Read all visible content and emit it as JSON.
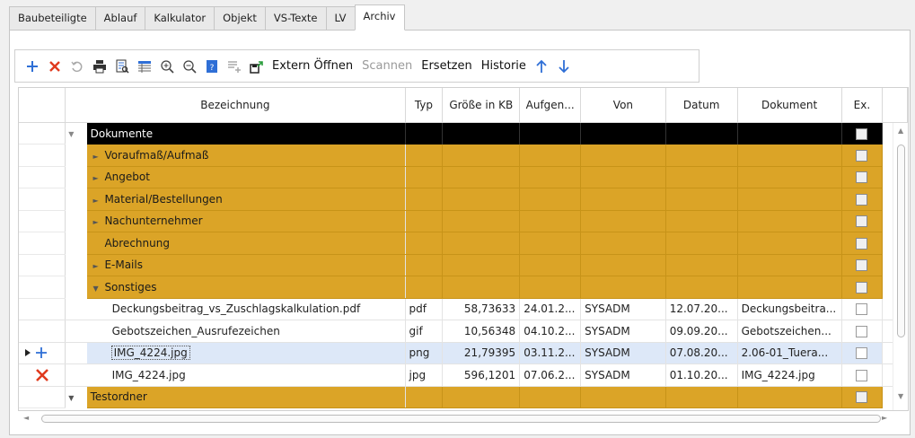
{
  "tabs": [
    {
      "label": "Baubeteiligte"
    },
    {
      "label": "Ablauf"
    },
    {
      "label": "Kalkulator"
    },
    {
      "label": "Objekt"
    },
    {
      "label": "VS-Texte"
    },
    {
      "label": "LV"
    },
    {
      "label": "Archiv"
    }
  ],
  "toolbar": {
    "extern_oeffnen": "Extern Öffnen",
    "scannen": "Scannen",
    "ersetzen": "Ersetzen",
    "historie": "Historie"
  },
  "colors": {
    "folder": "#dba427",
    "root": "#000000",
    "selected": "#dde8f8",
    "add": "#2f6fd6",
    "delete": "#e03a1e"
  },
  "grid": {
    "columns": [
      "Bezeichnung",
      "Typ",
      "Größe in KB",
      "Aufgen...",
      "Von",
      "Datum",
      "Dokument",
      "Ex."
    ],
    "root": "Dokumente",
    "folders_top": [
      {
        "name": "Voraufmaß/Aufmaß",
        "expander": "right"
      },
      {
        "name": "Angebot",
        "expander": "right"
      },
      {
        "name": "Material/Bestellungen",
        "expander": "right"
      },
      {
        "name": "Nachunternehmer",
        "expander": "right"
      },
      {
        "name": "Abrechnung",
        "expander": "none"
      },
      {
        "name": "E-Mails",
        "expander": "right"
      },
      {
        "name": "Sonstiges",
        "expander": "down"
      }
    ],
    "files": [
      {
        "name": "Deckungsbeitrag_vs_Zuschlagskalkulation.pdf",
        "typ": "pdf",
        "size": "58,73633",
        "aufgen": "24.01.2...",
        "von": "SYSADM",
        "datum": "12.07.20...",
        "dokument": "Deckungsbeitra...",
        "indicator": ""
      },
      {
        "name": "Gebotszeichen_Ausrufezeichen",
        "typ": "gif",
        "size": "10,56348",
        "aufgen": "04.10.2...",
        "von": "SYSADM",
        "datum": "09.09.20...",
        "dokument": "Gebotszeichen...",
        "indicator": ""
      },
      {
        "name": "IMG_4224.jpg",
        "typ": "png",
        "size": "21,79395",
        "aufgen": "03.11.2...",
        "von": "SYSADM",
        "datum": "07.08.20...",
        "dokument": "2.06-01_Tuera...",
        "indicator": "add",
        "selected": true
      },
      {
        "name": "IMG_4224.jpg",
        "typ": "jpg",
        "size": "596,1201",
        "aufgen": "07.06.2...",
        "von": "SYSADM",
        "datum": "01.10.20...",
        "dokument": "IMG_4224.jpg",
        "indicator": "delete"
      }
    ],
    "folders_bottom": [
      {
        "name": "Testordner",
        "expander": "down"
      }
    ]
  }
}
